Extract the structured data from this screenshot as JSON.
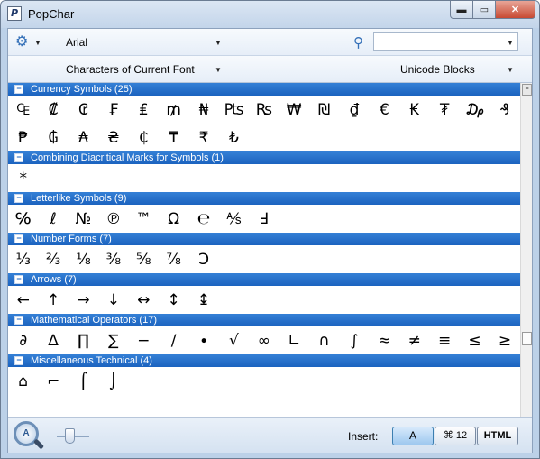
{
  "window": {
    "title": "PopChar",
    "app_icon": "P",
    "minimize": "▬",
    "maximize": "▭",
    "close": "✕"
  },
  "toolbar": {
    "settings_icon": "gear-icon",
    "font_name": "Arial",
    "search_icon": "magnifier-icon",
    "search_value": "",
    "view_label": "Characters of Current Font",
    "blocks_label": "Unicode Blocks"
  },
  "sections": [
    {
      "title": "Currency Symbols (25)",
      "rows": [
        [
          "₠",
          "₡",
          "₢",
          "₣",
          "₤",
          "₥",
          "₦",
          "₧",
          "₨",
          "₩",
          "₪",
          "₫",
          "€",
          "₭",
          "₮",
          "₯",
          "₰"
        ],
        [
          "₱",
          "₲",
          "₳",
          "₴",
          "₵",
          "₸",
          "₹",
          "₺"
        ]
      ]
    },
    {
      "title": "Combining Diacritical Marks for Symbols (1)",
      "rows": [
        [
          "*"
        ]
      ]
    },
    {
      "title": "Letterlike Symbols (9)",
      "rows": [
        [
          "℅",
          "ℓ",
          "№",
          "℗",
          "™",
          "Ω",
          "℮",
          "⅍",
          "Ⅎ"
        ]
      ]
    },
    {
      "title": "Number Forms (7)",
      "rows": [
        [
          "⅓",
          "⅔",
          "⅛",
          "⅜",
          "⅝",
          "⅞",
          "Ↄ"
        ]
      ]
    },
    {
      "title": "Arrows (7)",
      "rows": [
        [
          "←",
          "↑",
          "→",
          "↓",
          "↔",
          "↕",
          "↨"
        ]
      ]
    },
    {
      "title": "Mathematical Operators (17)",
      "rows": [
        [
          "∂",
          "∆",
          "∏",
          "∑",
          "−",
          "∕",
          "∙",
          "√",
          "∞",
          "∟",
          "∩",
          "∫",
          "≈",
          "≠",
          "≡",
          "≤",
          "≥"
        ]
      ]
    },
    {
      "title": "Miscellaneous Technical (4)",
      "rows": [
        [
          "⌂",
          "⌐",
          "⌠",
          "⌡"
        ]
      ]
    }
  ],
  "bottom": {
    "zoom_icon": "zoom-icon",
    "insert_label": "Insert:",
    "insert_a": "A",
    "insert_unicode": "12",
    "insert_html": "HTML"
  },
  "colors": {
    "section_header": "#1b63bf",
    "window_frame": "#bcd1e8"
  }
}
